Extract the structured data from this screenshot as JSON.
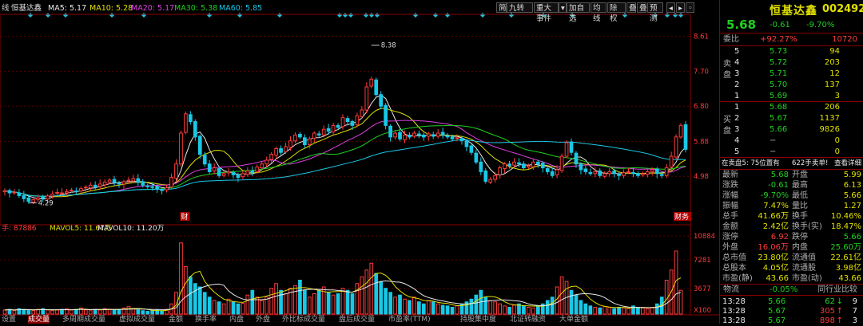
{
  "chart_data": {
    "type": "candlestick",
    "title": "恒基达鑫",
    "ma_legend": [
      {
        "label": "MA5: 5.17",
        "color": "#e8e8e8"
      },
      {
        "label": "MA10: 5.28",
        "color": "#e0e000"
      },
      {
        "label": "MA20: 5.17",
        "color": "#e040e0"
      },
      {
        "label": "MA30: 5.38",
        "color": "#20d020"
      },
      {
        "label": "MA60: 5.85",
        "color": "#19c8e6"
      }
    ],
    "price_axis": {
      "ticks": [
        "8.61",
        "7.70",
        "6.80",
        "5.88",
        "4.98"
      ],
      "ylim": [
        3.93,
        8.85
      ]
    },
    "annotations": {
      "high": "8.38",
      "low": "4.29",
      "marker1": "财",
      "marker2": "财务"
    },
    "volume_legend": {
      "label": "手: 87886",
      "mavol5": "MAVOL5: 11.67万",
      "mavol10": "MAVOL10: 11.20万"
    },
    "volume_axis": {
      "ticks": [
        "10884",
        "7281",
        "3677"
      ],
      "unit": "X100"
    },
    "prices": [
      4.61,
      4.55,
      4.57,
      4.48,
      4.4,
      4.33,
      4.38,
      4.42,
      4.41,
      4.47,
      4.52,
      4.56,
      4.55,
      4.58,
      4.62,
      4.6,
      4.66,
      4.7,
      4.75,
      4.7,
      4.78,
      4.83,
      4.88,
      4.82,
      4.78,
      4.84,
      4.88,
      4.92,
      4.82,
      4.75,
      4.71,
      4.69,
      4.65,
      4.63,
      4.68,
      4.95,
      5.3,
      6.1,
      6.6,
      6.4,
      6.0,
      5.55,
      5.3,
      5.1,
      5.2,
      5.0,
      5.05,
      5.1,
      5.02,
      4.95,
      5.05,
      5.12,
      5.08,
      5.22,
      5.3,
      5.4,
      5.55,
      5.7,
      5.6,
      5.75,
      5.9,
      6.05,
      6.0,
      5.8,
      5.95,
      6.1,
      6.05,
      6.2,
      6.15,
      6.3,
      6.25,
      6.5,
      6.4,
      6.3,
      6.55,
      6.7,
      7.3,
      7.5,
      7.1,
      6.8,
      6.3,
      6.0,
      6.1,
      5.95,
      6.05,
      6.0,
      6.1,
      6.05,
      6.0,
      6.08,
      6.02,
      6.1,
      6.05,
      6.0,
      5.95,
      5.98,
      5.9,
      5.75,
      5.6,
      5.35,
      5.1,
      4.85,
      4.9,
      5.0,
      5.2,
      5.3,
      5.25,
      5.35,
      5.3,
      5.2,
      5.25,
      5.35,
      5.3,
      5.2,
      5.1,
      5.0,
      5.15,
      5.5,
      5.85,
      5.6,
      5.3,
      5.15,
      5.1,
      5.05,
      5.1,
      5.0,
      5.05,
      5.1,
      5.05,
      5.0,
      5.08,
      5.1,
      5.05,
      5.0,
      5.05,
      5.1,
      5.15,
      5.05,
      5.0,
      5.2,
      5.5,
      6.0,
      6.3,
      5.68
    ],
    "volumes": [
      0.6,
      0.7,
      0.5,
      0.8,
      0.7,
      0.6,
      0.5,
      0.7,
      0.8,
      0.6,
      0.5,
      0.6,
      0.7,
      0.8,
      0.6,
      0.7,
      0.9,
      0.6,
      0.5,
      0.7,
      0.6,
      0.8,
      0.7,
      0.6,
      0.7,
      0.9,
      1.1,
      0.8,
      0.6,
      0.5,
      0.4,
      0.5,
      0.6,
      0.5,
      0.7,
      1.5,
      3.2,
      10.5,
      7.0,
      5.5,
      4.5,
      4.0,
      3.2,
      2.5,
      2.0,
      1.8,
      1.5,
      2.2,
      1.8,
      1.5,
      1.6,
      2.8,
      3.5,
      2.5,
      2.0,
      2.5,
      3.8,
      4.5,
      3.5,
      3.0,
      3.8,
      4.2,
      5.0,
      3.5,
      2.5,
      3.0,
      3.5,
      4.0,
      3.2,
      2.8,
      3.0,
      3.8,
      3.5,
      3.0,
      4.5,
      5.5,
      6.5,
      7.5,
      6.0,
      4.8,
      3.8,
      3.2,
      2.5,
      2.8,
      2.2,
      2.0,
      2.5,
      1.8,
      1.5,
      2.0,
      1.8,
      1.5,
      1.3,
      1.2,
      1.0,
      1.2,
      1.5,
      1.8,
      2.2,
      2.8,
      3.5,
      2.5,
      2.0,
      1.8,
      1.5,
      1.2,
      1.0,
      1.3,
      1.5,
      1.2,
      1.0,
      0.9,
      1.2,
      1.5,
      2.0,
      2.5,
      4.0,
      5.5,
      4.8,
      3.5,
      2.8,
      2.0,
      1.5,
      1.2,
      1.0,
      0.9,
      1.1,
      1.0,
      0.8,
      1.0,
      0.9,
      0.8,
      1.2,
      1.0,
      0.9,
      0.8,
      1.0,
      1.5,
      2.5,
      5.0,
      6.5,
      9.3,
      3.5
    ]
  },
  "toolbar": {
    "buttons": [
      "简",
      "九转",
      "重大事件",
      "▾",
      "加自选",
      "均线",
      "除权",
      "叠",
      "叠",
      "预测"
    ]
  },
  "panel": {
    "stock_name": "恒基达鑫",
    "stock_code": "002492",
    "price": "5.68",
    "change": "-0.61",
    "change_pct": "-9.70%",
    "webi_label": "委比",
    "webi_value": "+92.27%",
    "webi_diff": "10720",
    "sell_group": "卖盘",
    "buy_group": "买盘",
    "sells": [
      {
        "n": "5",
        "p": "5.73",
        "v": "94"
      },
      {
        "n": "4",
        "p": "5.72",
        "v": "203"
      },
      {
        "n": "3",
        "p": "5.71",
        "v": "12"
      },
      {
        "n": "2",
        "p": "5.70",
        "v": "137"
      },
      {
        "n": "1",
        "p": "5.69",
        "v": "3"
      }
    ],
    "buys": [
      {
        "n": "1",
        "p": "5.68",
        "v": "206"
      },
      {
        "n": "2",
        "p": "5.67",
        "v": "1137"
      },
      {
        "n": "3",
        "p": "5.66",
        "v": "9826"
      },
      {
        "n": "4",
        "p": "−",
        "v": "0"
      },
      {
        "n": "5",
        "p": "−",
        "v": "0"
      }
    ],
    "order_info": {
      "left": "在卖盘5: 75位置有",
      "mid": "622手",
      "right1": "卖单!",
      "right2": "查看详细"
    },
    "stats": [
      {
        "l1": "最新",
        "v1": "5.68",
        "c1": "green",
        "l2": "开盘",
        "v2": "5.99",
        "c2": "yellow"
      },
      {
        "l1": "涨跌",
        "v1": "-0.61",
        "c1": "green",
        "l2": "最高",
        "v2": "6.13",
        "c2": "yellow"
      },
      {
        "l1": "涨幅",
        "v1": "-9.70%",
        "c1": "green",
        "l2": "最低",
        "v2": "5.66",
        "c2": "yellow"
      },
      {
        "l1": "振幅",
        "v1": "7.47%",
        "c1": "yellow",
        "l2": "量比",
        "v2": "1.27",
        "c2": "yellow"
      },
      {
        "l1": "总手",
        "v1": "41.66万",
        "c1": "yellow",
        "l2": "换手",
        "v2": "10.46%",
        "c2": "yellow"
      },
      {
        "l1": "金额",
        "v1": "2.42亿",
        "c1": "yellow",
        "l2": "换手(实)",
        "v2": "18.47%",
        "c2": "yellow"
      },
      {
        "l1": "涨停",
        "v1": "6.92",
        "c1": "red",
        "l2": "跌停",
        "v2": "5.66",
        "c2": "green"
      },
      {
        "l1": "外盘",
        "v1": "16.06万",
        "c1": "red",
        "l2": "内盘",
        "v2": "25.60万",
        "c2": "green"
      },
      {
        "l1": "总市值",
        "v1": "23.80亿",
        "c1": "yellow",
        "l2": "流通值",
        "v2": "22.61亿",
        "c2": "yellow"
      },
      {
        "l1": "总股本",
        "v1": "4.05亿",
        "c1": "yellow",
        "l2": "流通股",
        "v2": "3.98亿",
        "c2": "yellow"
      },
      {
        "l1": "市盈(静)",
        "v1": "43.66",
        "c1": "yellow",
        "l2": "市盈(动)",
        "v2": "43.66",
        "c2": "yellow"
      }
    ],
    "tick_header": {
      "left": "物流",
      "pct": "-0.05%",
      "right": "同行业比较"
    },
    "ticks": [
      {
        "t": "13:28",
        "p": "5.66",
        "v": "62",
        "dir": "down",
        "n": "9"
      },
      {
        "t": "13:28",
        "p": "5.67",
        "v": "305",
        "dir": "up",
        "n": "7"
      },
      {
        "t": "13:28",
        "p": "5.67",
        "v": "898",
        "dir": "up",
        "n": "3"
      }
    ]
  },
  "bottom_tabs": [
    "设置",
    "成交量",
    "多周期成交量",
    "虚拟成交量",
    "金额",
    "换手率",
    "内盘",
    "外盘",
    "外比标成交量",
    "盘后成交量",
    "市盈率(TTM)",
    "持股集中度",
    "北证转融资",
    "大单金额"
  ]
}
